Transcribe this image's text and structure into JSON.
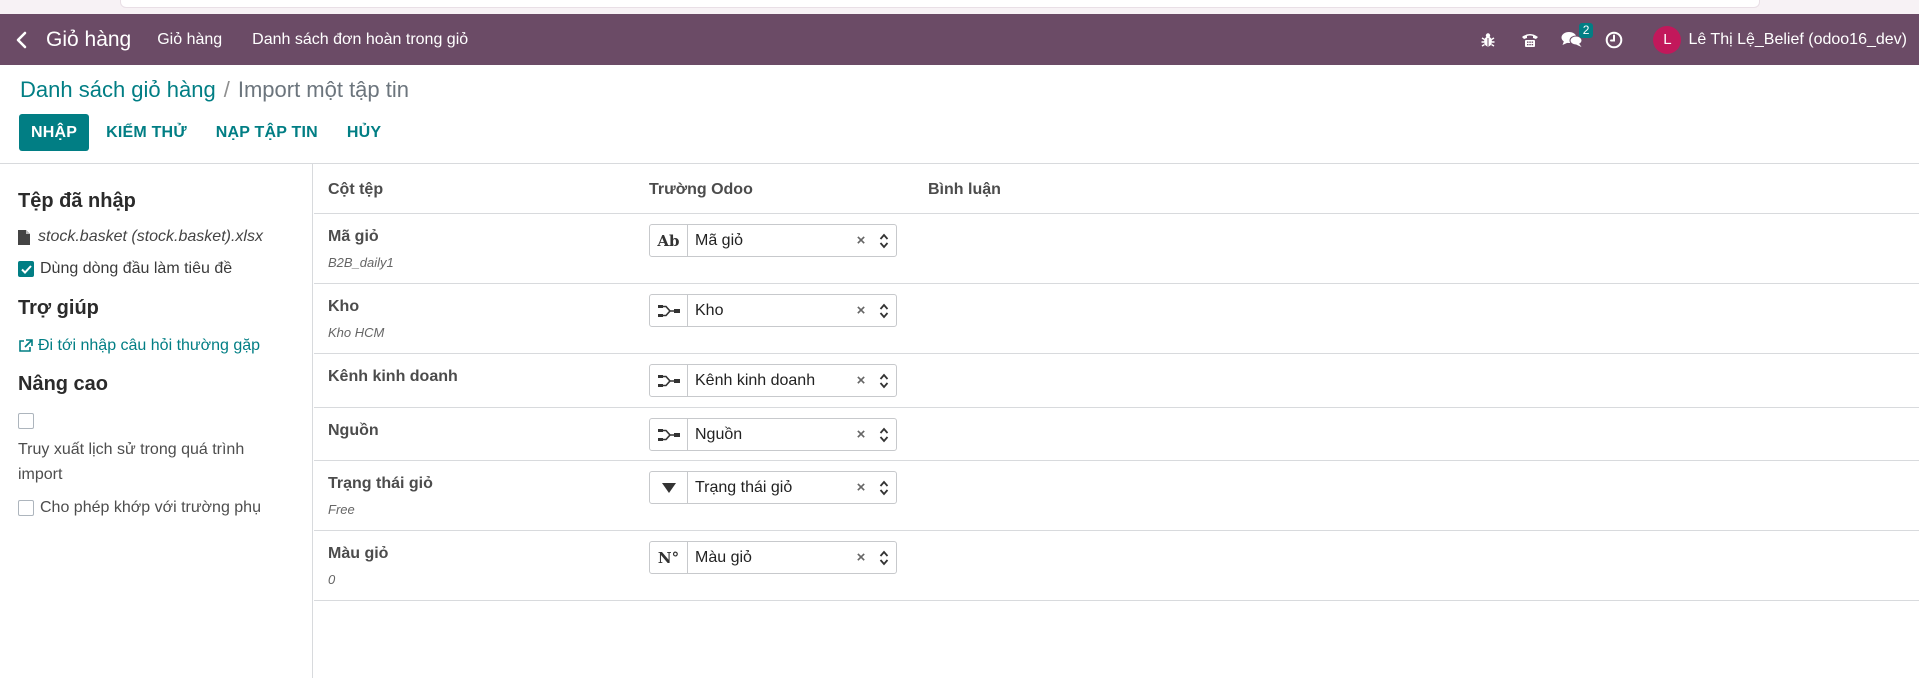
{
  "nav": {
    "app_name": "Giỏ hàng",
    "menus": [
      "Giỏ hàng",
      "Danh sách đơn hoàn trong giỏ"
    ],
    "chat_badge": "2",
    "avatar_letter": "L",
    "user": "Lê Thị Lệ_Belief (odoo16_dev)",
    "bar_color": "#6b4b66"
  },
  "breadcrumb": {
    "parent": "Danh sách giỏ hàng",
    "separator": "/",
    "current": "Import một tập tin"
  },
  "actions": {
    "import": "NHẬP",
    "test": "KIỂM THỬ",
    "load_file": "NẠP TẬP TIN",
    "cancel": "HỦY"
  },
  "sidebar": {
    "imported_heading": "Tệp đã nhập",
    "file_name": "stock.basket (stock.basket).xlsx",
    "first_row_header": "Dùng dòng đầu làm tiêu đề",
    "help_heading": "Trợ giúp",
    "faq_link": "Đi tới nhập câu hỏi thường gặp",
    "advanced_heading": "Nâng cao",
    "track_history_line1": "Truy xuất lịch sử trong quá trình",
    "track_history_line2": "import",
    "allow_subfields": "Cho phép khớp với trường phụ"
  },
  "table": {
    "headers": [
      "Cột tệp",
      "Trường Odoo",
      "Bình luận"
    ],
    "rows": [
      {
        "column": "Mã giỏ",
        "sample": "B2B_daily1",
        "type_icon": "text-icon",
        "field": "Mã giỏ"
      },
      {
        "column": "Kho",
        "sample": "Kho HCM",
        "type_icon": "relation-icon",
        "field": "Kho"
      },
      {
        "column": "Kênh kinh doanh",
        "sample": "",
        "type_icon": "relation-icon",
        "field": "Kênh kinh doanh"
      },
      {
        "column": "Nguồn",
        "sample": "",
        "type_icon": "relation-icon",
        "field": "Nguồn"
      },
      {
        "column": "Trạng thái giỏ",
        "sample": "Free",
        "type_icon": "selection-icon",
        "field": "Trạng thái giỏ"
      },
      {
        "column": "Màu giỏ",
        "sample": "0",
        "type_icon": "number-icon",
        "field": "Màu giỏ"
      }
    ]
  },
  "type_glyphs": {
    "text": "Ab",
    "number": "N°"
  },
  "accent_color": "#017e84"
}
